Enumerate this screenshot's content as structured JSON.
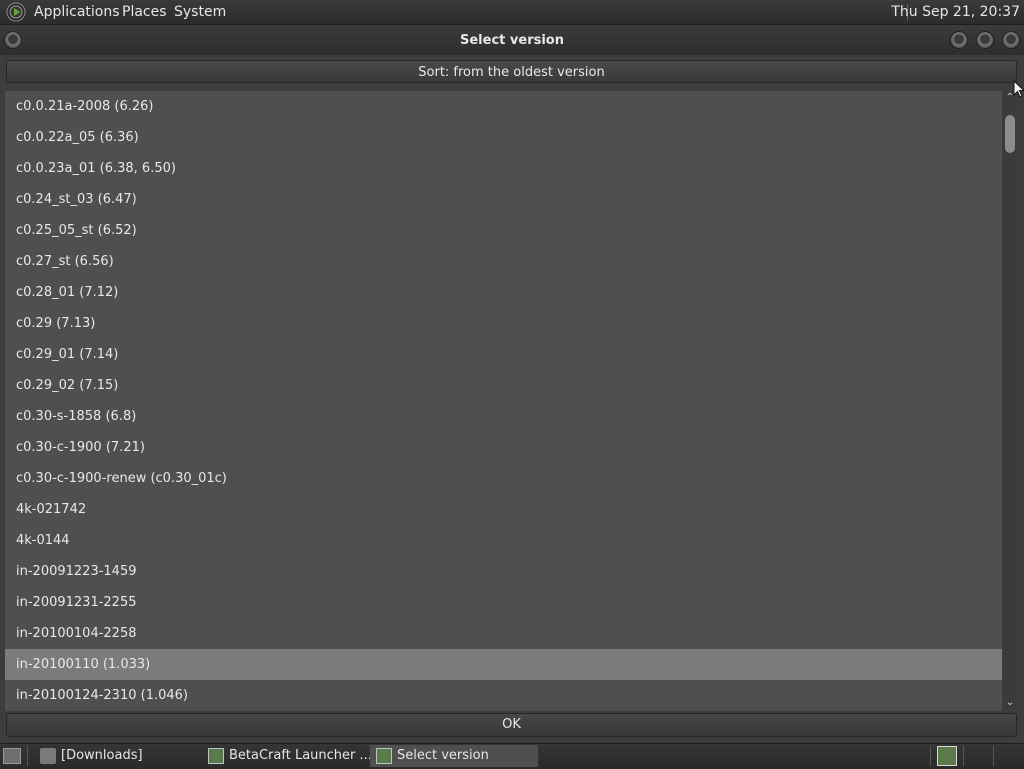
{
  "top_panel": {
    "menus": [
      "Applications",
      "Places",
      "System"
    ],
    "clock": "Thu Sep 21, 20:37"
  },
  "window": {
    "title": "Select version",
    "sort_button": "Sort: from the oldest version",
    "versions": [
      "c0.0.21a-2008 (6.26)",
      "c0.0.22a_05 (6.36)",
      "c0.0.23a_01 (6.38, 6.50)",
      "c0.24_st_03 (6.47)",
      "c0.25_05_st (6.52)",
      "c0.27_st (6.56)",
      "c0.28_01 (7.12)",
      "c0.29 (7.13)",
      "c0.29_01 (7.14)",
      "c0.29_02 (7.15)",
      "c0.30-s-1858 (6.8)",
      "c0.30-c-1900 (7.21)",
      "c0.30-c-1900-renew (c0.30_01c)",
      "4k-021742",
      "4k-0144",
      "in-20091223-1459",
      "in-20091231-2255",
      "in-20100104-2258",
      "in-20100110 (1.033)",
      "in-20100124-2310 (1.046)"
    ],
    "selected_index": 18,
    "ok_button": "OK"
  },
  "taskbar": {
    "tasks": [
      {
        "label": "[Downloads]",
        "icon": "folder-icon",
        "active": false
      },
      {
        "label": "BetaCraft Launcher ...",
        "icon": "betacraft-icon",
        "active": false
      },
      {
        "label": "Select version",
        "icon": "betacraft-icon",
        "active": true
      }
    ]
  },
  "colors": {
    "list_bg": "#4f4f4f",
    "selected_row": "#7b7b7b",
    "panel": "#2e2e2e"
  }
}
